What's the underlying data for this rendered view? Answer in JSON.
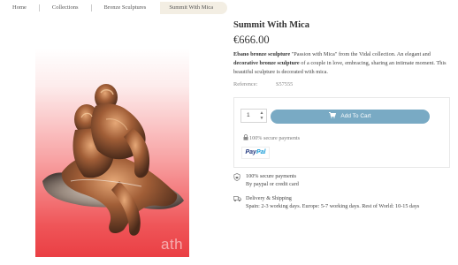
{
  "breadcrumb": {
    "items": [
      "Home",
      "Collections",
      "Bronze Sculptures",
      "Summit With Mica"
    ]
  },
  "product": {
    "title": "Summit With Mica",
    "price": "€666.00",
    "description_parts": [
      {
        "text": "Ebano bronze sculpture",
        "bold": true
      },
      {
        "text": " \"Passion with Mica\" from the Vidal collection. An elegant and ",
        "bold": false
      },
      {
        "text": "decorative bronze sculpture",
        "bold": true
      },
      {
        "text": " of a couple in love, embracing, sharing an intimate moment. This beautiful sculpture is decorated with mica.",
        "bold": false
      }
    ],
    "reference_label": "Reference:",
    "reference_value": "S57555",
    "image_watermark": "ath"
  },
  "cart": {
    "quantity": "1",
    "add_to_cart_label": "Add To Cart",
    "secure_payments": "100% secure payments",
    "paypal_part1": "Pay",
    "paypal_part2": "Pal"
  },
  "reassurance": {
    "secure_title": "100% secure payments",
    "secure_sub": "By paypal or credit card",
    "shipping_title": "Delivery & Shipping",
    "shipping_sub": "Spain: 2-3 working days. Europe: 5-7 working days. Rest of World: 10-15 days"
  },
  "colors": {
    "accent_button": "#79aac4",
    "breadcrumb_active_bg": "#f3eee3",
    "image_gradient_end": "#ea3f44",
    "paypal_dark": "#253b80",
    "paypal_light": "#179bd7"
  },
  "icons": [
    "cart-icon",
    "lock-icon",
    "shield-icon",
    "truck-icon",
    "chevron-up-icon",
    "chevron-down-icon"
  ]
}
